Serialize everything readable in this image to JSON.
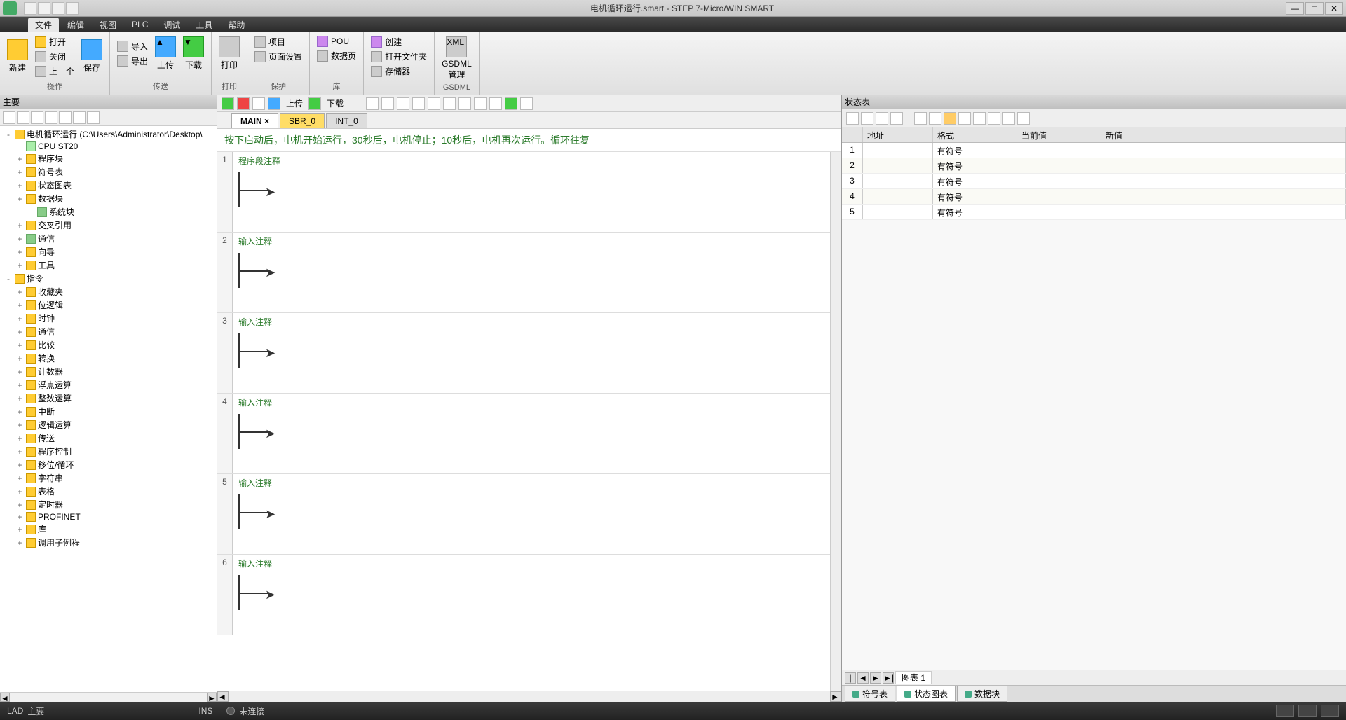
{
  "title": "电机循环运行.smart - STEP 7-Micro/WIN SMART",
  "menu_tabs": [
    "文件",
    "编辑",
    "视图",
    "PLC",
    "调试",
    "工具",
    "帮助"
  ],
  "ribbon": {
    "g1_big": "新建",
    "g2_big": "保存",
    "g2_items": [
      "打开",
      "关闭",
      "上一个"
    ],
    "g3_items": [
      "导入",
      "导出"
    ],
    "g3_up": "上传",
    "g3_down": "下载",
    "g4_big": "打印",
    "g5_items": [
      "项目",
      "页面设置"
    ],
    "g5_sub1": "POU",
    "g5_sub2": "数据页",
    "g6_items": [
      "创建",
      "打开文件夹"
    ],
    "g6_sub": "存储器",
    "g7_big": "GSDML\n管理",
    "g7_label": "GSDML"
  },
  "left": {
    "header": "主要",
    "root": "电机循环运行 (C:\\Users\\Administrator\\Desktop\\",
    "items": [
      {
        "l": 1,
        "t": "chip",
        "txt": "CPU ST20"
      },
      {
        "l": 1,
        "t": "folder-y",
        "txt": "程序块",
        "exp": "+"
      },
      {
        "l": 1,
        "t": "folder-y",
        "txt": "符号表",
        "exp": "+"
      },
      {
        "l": 1,
        "t": "folder-y",
        "txt": "状态图表",
        "exp": "+"
      },
      {
        "l": 1,
        "t": "folder-y",
        "txt": "数据块",
        "exp": "+"
      },
      {
        "l": 2,
        "t": "folder-g",
        "txt": "系统块"
      },
      {
        "l": 1,
        "t": "folder-y",
        "txt": "交叉引用",
        "exp": "+"
      },
      {
        "l": 1,
        "t": "folder-g",
        "txt": "通信",
        "exp": "+"
      },
      {
        "l": 1,
        "t": "folder-y",
        "txt": "向导",
        "exp": "+"
      },
      {
        "l": 1,
        "t": "folder-y",
        "txt": "工具",
        "exp": "+"
      },
      {
        "l": 0,
        "t": "folder-y",
        "txt": "指令",
        "exp": "-"
      },
      {
        "l": 1,
        "t": "folder-y",
        "txt": "收藏夹",
        "exp": "+"
      },
      {
        "l": 1,
        "t": "folder-y",
        "txt": "位逻辑",
        "exp": "+"
      },
      {
        "l": 1,
        "t": "folder-y",
        "txt": "时钟",
        "exp": "+"
      },
      {
        "l": 1,
        "t": "folder-y",
        "txt": "通信",
        "exp": "+"
      },
      {
        "l": 1,
        "t": "folder-y",
        "txt": "比较",
        "exp": "+"
      },
      {
        "l": 1,
        "t": "folder-y",
        "txt": "转换",
        "exp": "+"
      },
      {
        "l": 1,
        "t": "folder-y",
        "txt": "计数器",
        "exp": "+"
      },
      {
        "l": 1,
        "t": "folder-y",
        "txt": "浮点运算",
        "exp": "+"
      },
      {
        "l": 1,
        "t": "folder-y",
        "txt": "整数运算",
        "exp": "+"
      },
      {
        "l": 1,
        "t": "folder-y",
        "txt": "中断",
        "exp": "+"
      },
      {
        "l": 1,
        "t": "folder-y",
        "txt": "逻辑运算",
        "exp": "+"
      },
      {
        "l": 1,
        "t": "folder-y",
        "txt": "传送",
        "exp": "+"
      },
      {
        "l": 1,
        "t": "folder-y",
        "txt": "程序控制",
        "exp": "+"
      },
      {
        "l": 1,
        "t": "folder-y",
        "txt": "移位/循环",
        "exp": "+"
      },
      {
        "l": 1,
        "t": "folder-y",
        "txt": "字符串",
        "exp": "+"
      },
      {
        "l": 1,
        "t": "folder-y",
        "txt": "表格",
        "exp": "+"
      },
      {
        "l": 1,
        "t": "folder-y",
        "txt": "定时器",
        "exp": "+"
      },
      {
        "l": 1,
        "t": "folder-y",
        "txt": "PROFINET",
        "exp": "+"
      },
      {
        "l": 1,
        "t": "folder-y",
        "txt": "库",
        "exp": "+"
      },
      {
        "l": 1,
        "t": "folder-y",
        "txt": "调用子例程",
        "exp": "+"
      }
    ]
  },
  "editor": {
    "tb_upload": "上传",
    "tb_download": "下载",
    "tabs": [
      "MAIN",
      "SBR_0",
      "INT_0"
    ],
    "comment": "按下启动后，电机开始运行，30秒后，电机停止；10秒后，电机再次运行。循环往复",
    "networks": [
      {
        "n": "1",
        "title": "程序段注释"
      },
      {
        "n": "2",
        "title": "输入注释"
      },
      {
        "n": "3",
        "title": "输入注释"
      },
      {
        "n": "4",
        "title": "输入注释"
      },
      {
        "n": "5",
        "title": "输入注释"
      },
      {
        "n": "6",
        "title": "输入注释"
      }
    ]
  },
  "right": {
    "header": "状态表",
    "cols": [
      "",
      "地址",
      "格式",
      "当前值",
      "新值"
    ],
    "rows": [
      {
        "n": "1",
        "fmt": "有符号"
      },
      {
        "n": "2",
        "fmt": "有符号"
      },
      {
        "n": "3",
        "fmt": "有符号"
      },
      {
        "n": "4",
        "fmt": "有符号"
      },
      {
        "n": "5",
        "fmt": "有符号"
      }
    ],
    "nav_label": "图表 1",
    "btabs": [
      "符号表",
      "状态图表",
      "数据块"
    ]
  },
  "status": {
    "s1": "LAD",
    "s2": "主要",
    "s3": "INS",
    "s4": "未连接"
  }
}
